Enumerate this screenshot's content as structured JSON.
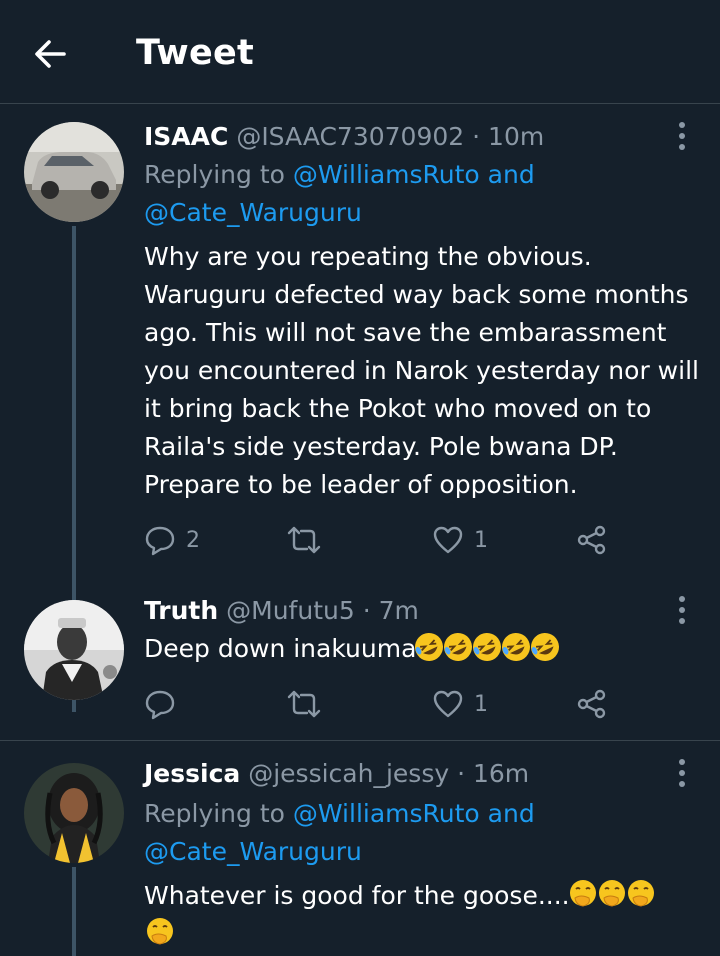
{
  "header": {
    "title": "Tweet",
    "back_icon": "arrow-left-icon"
  },
  "colors": {
    "background": "#15202b",
    "text": "#ffffff",
    "muted": "#8b98a5",
    "link": "#1d9bf0",
    "divider": "#38444d"
  },
  "replies": [
    {
      "name": "ISAAC",
      "handle": "@ISAAC73070902",
      "separator": "·",
      "time": "10m",
      "replying_prefix": "Replying to ",
      "replying_user1": "@WilliamsRuto",
      "replying_and": " and",
      "replying_user2": "@Cate_Waruguru",
      "text": "Why are you repeating the obvious. Waruguru defected way back some months ago. This will not save the embarassment you encountered in Narok yesterday nor will it bring back the Pokot who moved on to Raila's side yesterday. Pole bwana DP. Prepare to be leader of opposition.",
      "reply_count": "2",
      "retweet_count": "",
      "like_count": "1"
    },
    {
      "name": "Truth",
      "handle": "@Mufutu5",
      "separator": "·",
      "time": "7m",
      "text": "Deep down inakuuma",
      "emoji": "rolling-on-floor-laughing",
      "emoji_count": 5,
      "reply_count": "",
      "retweet_count": "",
      "like_count": "1"
    },
    {
      "name": "Jessica",
      "handle": "@jessicah_jessy",
      "separator": "·",
      "time": "16m",
      "replying_prefix": "Replying to ",
      "replying_user1": "@WilliamsRuto",
      "replying_and": " and",
      "replying_user2": "@Cate_Waruguru",
      "text": "Whatever is good for the goose....",
      "emoji": "face-with-hand-over-mouth",
      "emoji_count": 4
    }
  ]
}
